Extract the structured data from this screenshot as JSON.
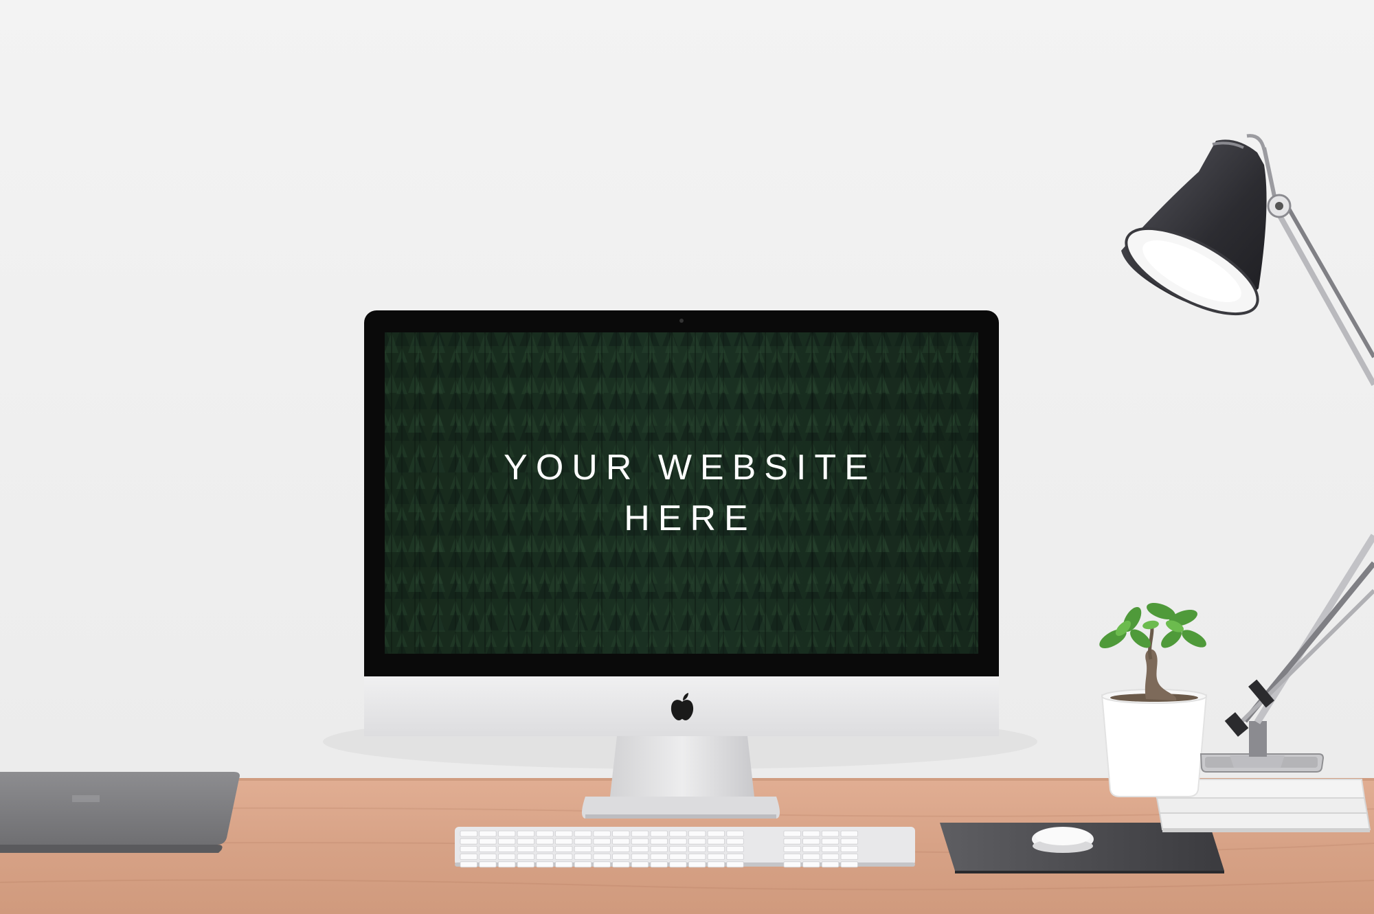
{
  "screen": {
    "headline_line1": "YOUR WEBSITE",
    "headline_line2": "HERE"
  },
  "colors": {
    "wall": "#f2f2f2",
    "desk": "#d9a58a",
    "forest_dark": "#16261c",
    "forest_mid": "#1f3a28",
    "bezel": "#0a0a0a",
    "aluminum": "#e6e6e8",
    "lamp_shade": "#2f2f33"
  },
  "icons": {
    "logo": "apple-logo-icon"
  }
}
